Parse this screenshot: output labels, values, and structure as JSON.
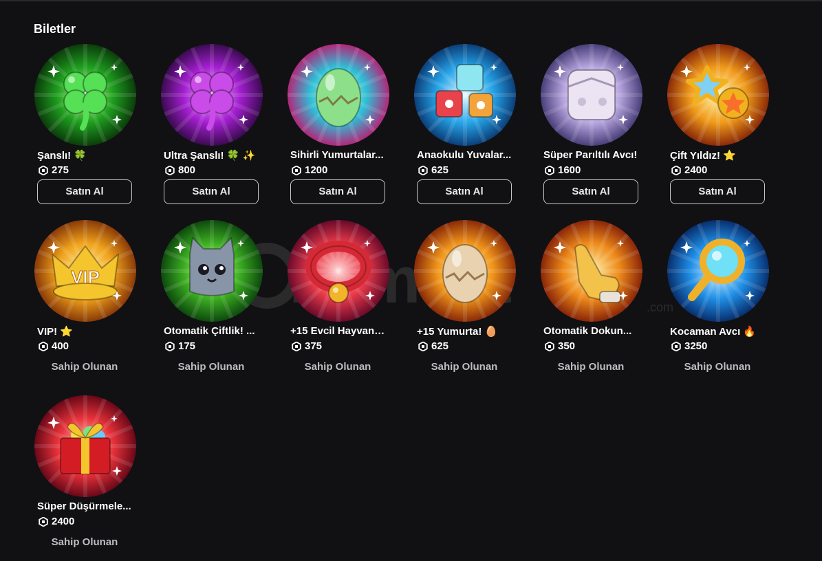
{
  "section": {
    "title": "Biletler"
  },
  "buy_label": "Satın Al",
  "owned_label": "Sahip Olunan",
  "watermark": {
    "text": "itemsat",
    "sub": ".com"
  },
  "items": [
    {
      "title": "Şanslı! 🍀",
      "price": "275",
      "status": "buy",
      "icon": "clover-icon",
      "colors": [
        "#b6ff8a",
        "#1e9e1e",
        "#0b3d0b"
      ],
      "glyph": "clover",
      "glyph_color": "#55e055"
    },
    {
      "title": "Ultra Şanslı! 🍀 ✨",
      "price": "800",
      "status": "buy",
      "icon": "ultra-clover-icon",
      "colors": [
        "#f6b3ff",
        "#a41fd1",
        "#3c0a52"
      ],
      "glyph": "clover",
      "glyph_color": "#c94be8"
    },
    {
      "title": "Sihirli Yumurtalar...",
      "price": "1200",
      "status": "buy",
      "icon": "magic-egg-icon",
      "colors": [
        "#fff3a0",
        "#2cc0d8",
        "#b0287a"
      ],
      "glyph": "egg",
      "glyph_color": "#8de08a"
    },
    {
      "title": "Anaokulu Yuvalar...",
      "price": "625",
      "status": "buy",
      "icon": "toy-blocks-icon",
      "colors": [
        "#d9f7ff",
        "#26a4e8",
        "#0b3f7a"
      ],
      "glyph": "blocks",
      "glyph_color": "#8ee6f0"
    },
    {
      "title": "Süper Parıltılı Avcı!",
      "price": "1600",
      "status": "buy",
      "icon": "shiny-dice-icon",
      "colors": [
        "#ffffff",
        "#b8a6e0",
        "#4a3f7a"
      ],
      "glyph": "dice",
      "glyph_color": "#ece4f2"
    },
    {
      "title": "Çift Yıldız! ⭐",
      "price": "2400",
      "status": "buy",
      "icon": "double-star-icon",
      "colors": [
        "#fff2a0",
        "#f09a1a",
        "#8a2a08"
      ],
      "glyph": "stars",
      "glyph_color": "#f2b21e"
    },
    {
      "title": "VIP! ⭐",
      "price": "400",
      "status": "owned",
      "icon": "vip-crown-icon",
      "colors": [
        "#fff2a0",
        "#f0a21a",
        "#8a3a08"
      ],
      "glyph": "crown",
      "glyph_color": "#f5c52e"
    },
    {
      "title": "Otomatik Çiftlik! ...",
      "price": "175",
      "status": "owned",
      "icon": "cat-pet-icon",
      "colors": [
        "#d8ff9a",
        "#3cae22",
        "#0d4a0d"
      ],
      "glyph": "cat",
      "glyph_color": "#8894a8"
    },
    {
      "title": "+15 Evcil Hayvan! ...",
      "price": "375",
      "status": "owned",
      "icon": "pet-collar-icon",
      "colors": [
        "#ffc7c7",
        "#e83a4a",
        "#6a0a2a"
      ],
      "glyph": "collar",
      "glyph_color": "#d52a36"
    },
    {
      "title": "+15 Yumurta! 🥚",
      "price": "625",
      "status": "owned",
      "icon": "egg-icon",
      "colors": [
        "#fff2a0",
        "#f0951a",
        "#8a2a08"
      ],
      "glyph": "egg",
      "glyph_color": "#e9d2b0"
    },
    {
      "title": "Otomatik Dokun...",
      "price": "350",
      "status": "owned",
      "icon": "tap-hand-icon",
      "colors": [
        "#fff0a0",
        "#ee8a1a",
        "#8a2608"
      ],
      "glyph": "hand",
      "glyph_color": "#f3c24a"
    },
    {
      "title": "Kocaman Avcı 🔥",
      "price": "3250",
      "status": "owned",
      "icon": "magnifier-icon",
      "colors": [
        "#d6f4ff",
        "#1f8ee6",
        "#082f6e"
      ],
      "glyph": "magnifier",
      "glyph_color": "#f0b12a"
    },
    {
      "title": "Süper Düşürmele...",
      "price": "2400",
      "status": "owned",
      "icon": "gift-box-icon",
      "colors": [
        "#ffd0c0",
        "#e8323a",
        "#6a0818"
      ],
      "glyph": "gift",
      "glyph_color": "#d41c24"
    }
  ]
}
